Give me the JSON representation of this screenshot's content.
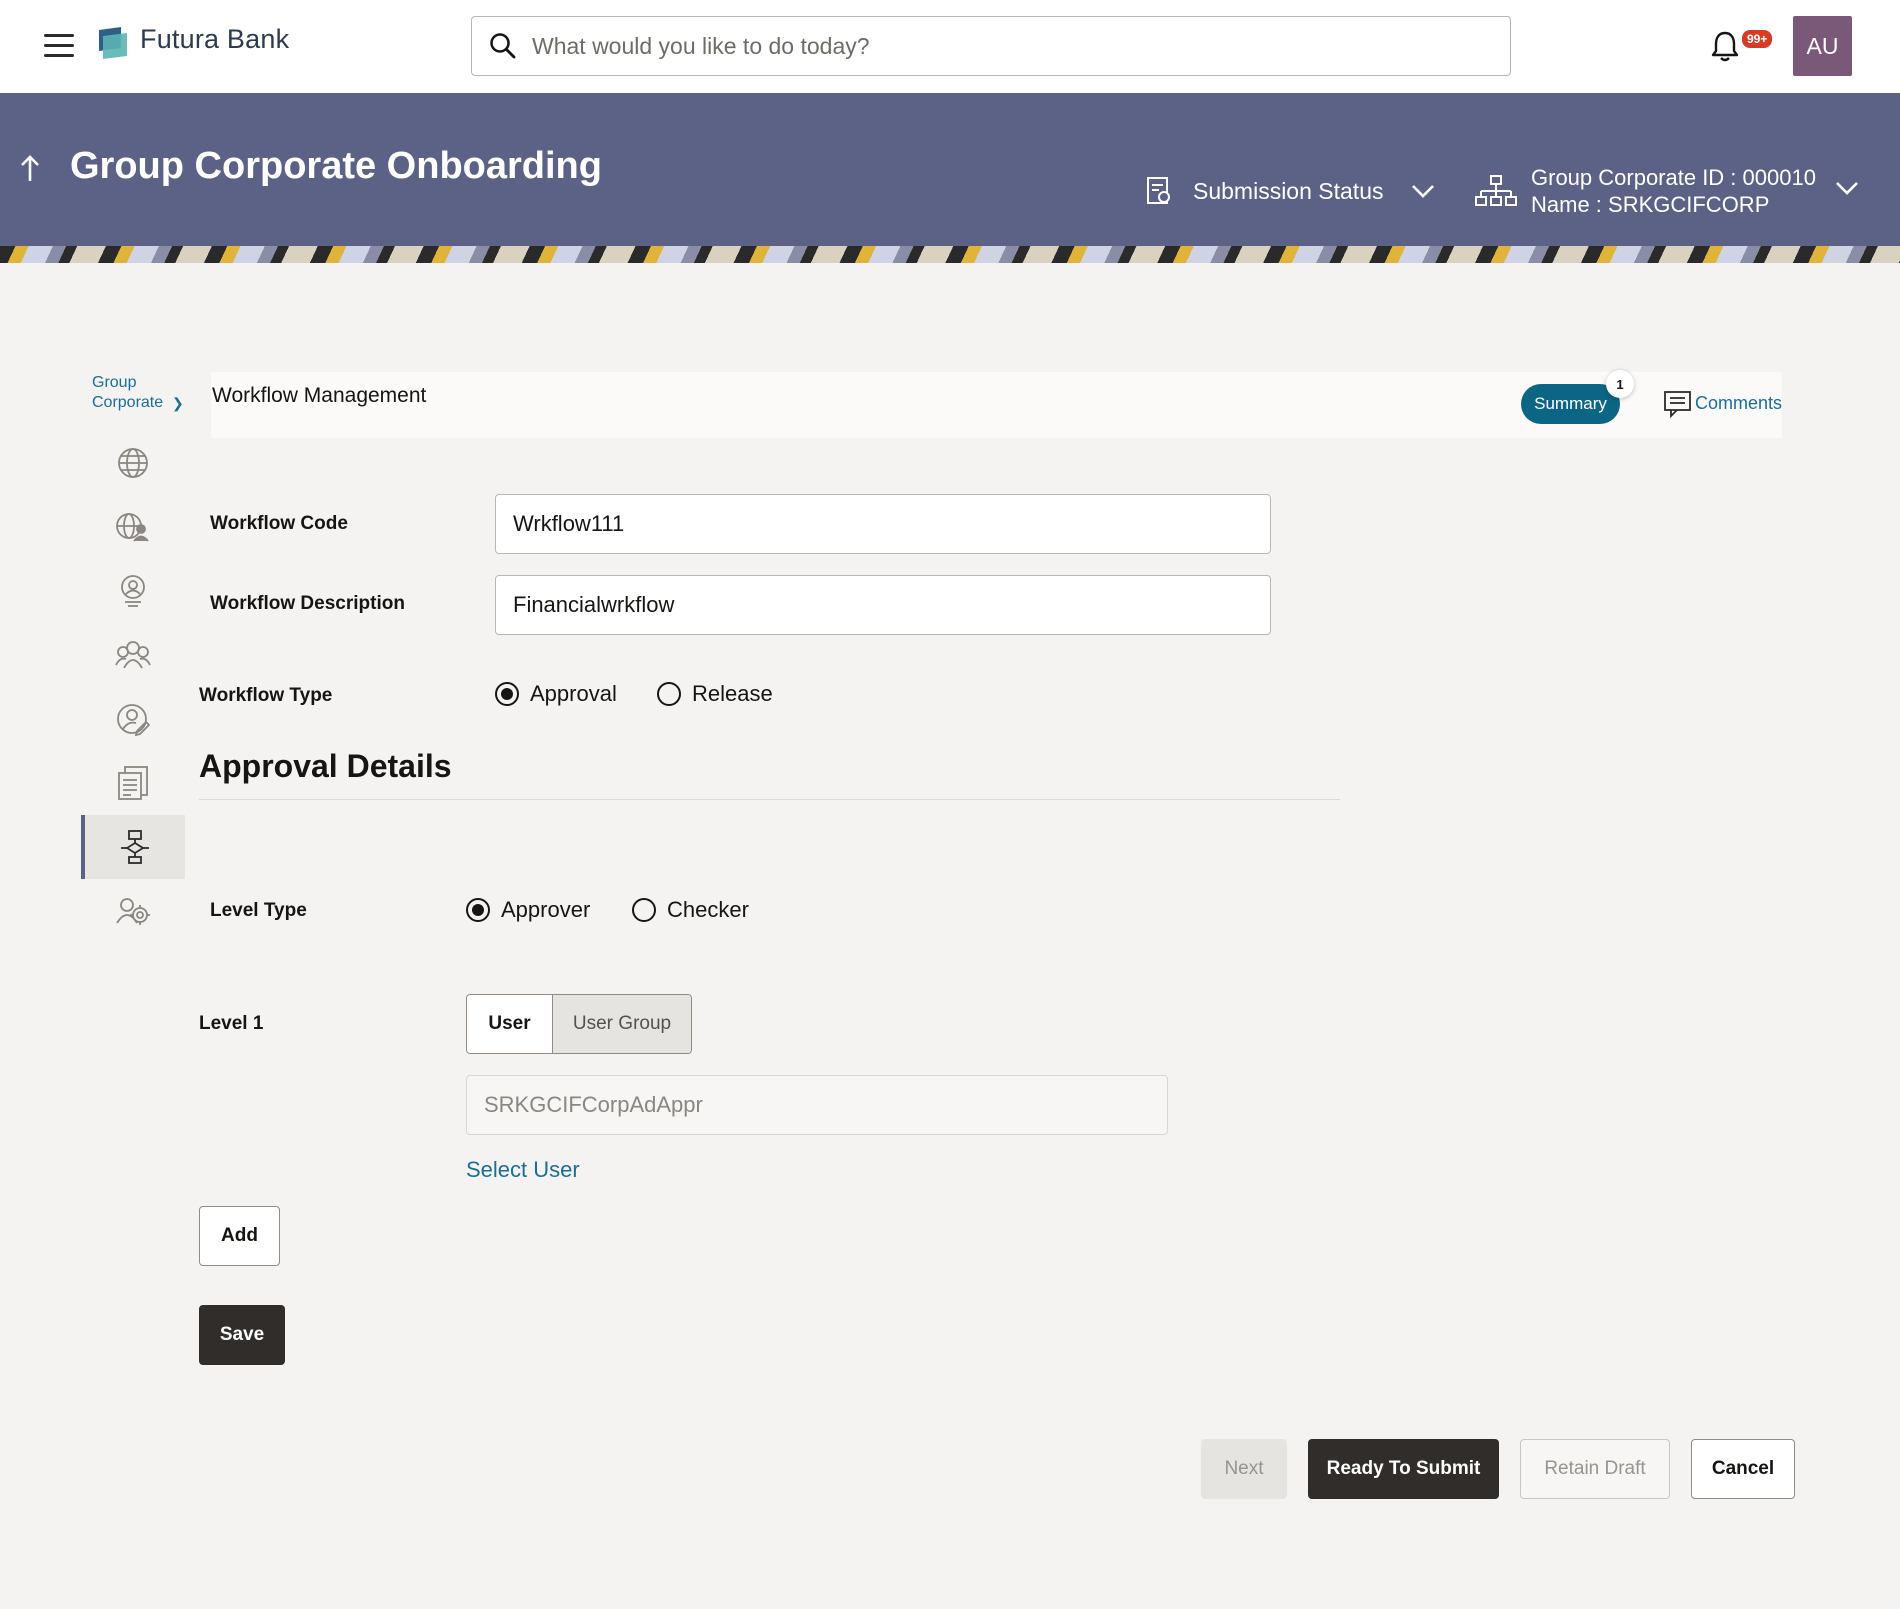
{
  "header": {
    "brand": "Futura Bank",
    "search_placeholder": "What would you like to do today?",
    "notification_badge": "99+",
    "avatar_initials": "AU"
  },
  "banner": {
    "title": "Group Corporate Onboarding",
    "submission_status": "Submission Status",
    "group_corporate_id": "Group Corporate ID : 000010",
    "group_corporate_name": "Name : SRKGCIFCORP"
  },
  "steps": {
    "crumb_line1": "Group",
    "crumb_line2": "Corporate",
    "items": [
      {
        "icon": "globe-icon"
      },
      {
        "icon": "globe-user-icon"
      },
      {
        "icon": "user-badge-icon"
      },
      {
        "icon": "users-group-icon"
      },
      {
        "icon": "user-edit-icon"
      },
      {
        "icon": "document-list-icon"
      },
      {
        "icon": "workflow-icon",
        "active": true
      },
      {
        "icon": "users-settings-icon"
      }
    ]
  },
  "section": {
    "title": "Workflow Management",
    "summary_label": "Summary",
    "summary_count": "1",
    "comments_label": "Comments"
  },
  "form": {
    "workflow_code_label": "Workflow Code",
    "workflow_code_value": "Wrkflow111",
    "workflow_description_label": "Workflow Description",
    "workflow_description_value": "Financialwrkflow",
    "workflow_type_label": "Workflow Type",
    "workflow_type_options": [
      "Approval",
      "Release"
    ],
    "workflow_type_selected": "Approval",
    "approval_details_heading": "Approval Details",
    "level_type_label": "Level Type",
    "level_type_options": [
      "Approver",
      "Checker"
    ],
    "level_type_selected": "Approver",
    "level1_label": "Level 1",
    "level1_tabs": [
      "User",
      "User Group"
    ],
    "level1_tab_selected": "User",
    "level1_user_value": "SRKGCIFCorpAdAppr",
    "select_user_link": "Select User",
    "add_button": "Add",
    "save_button": "Save"
  },
  "footer": {
    "next": "Next",
    "ready_to_submit": "Ready To Submit",
    "retain_draft": "Retain Draft",
    "cancel": "Cancel"
  },
  "colors": {
    "banner": "#5c6286",
    "accent_link": "#1a6e96",
    "summary_pill": "#0c6584",
    "primary_button": "#312d2a",
    "badge": "#d63b25",
    "avatar": "#7a5878"
  }
}
